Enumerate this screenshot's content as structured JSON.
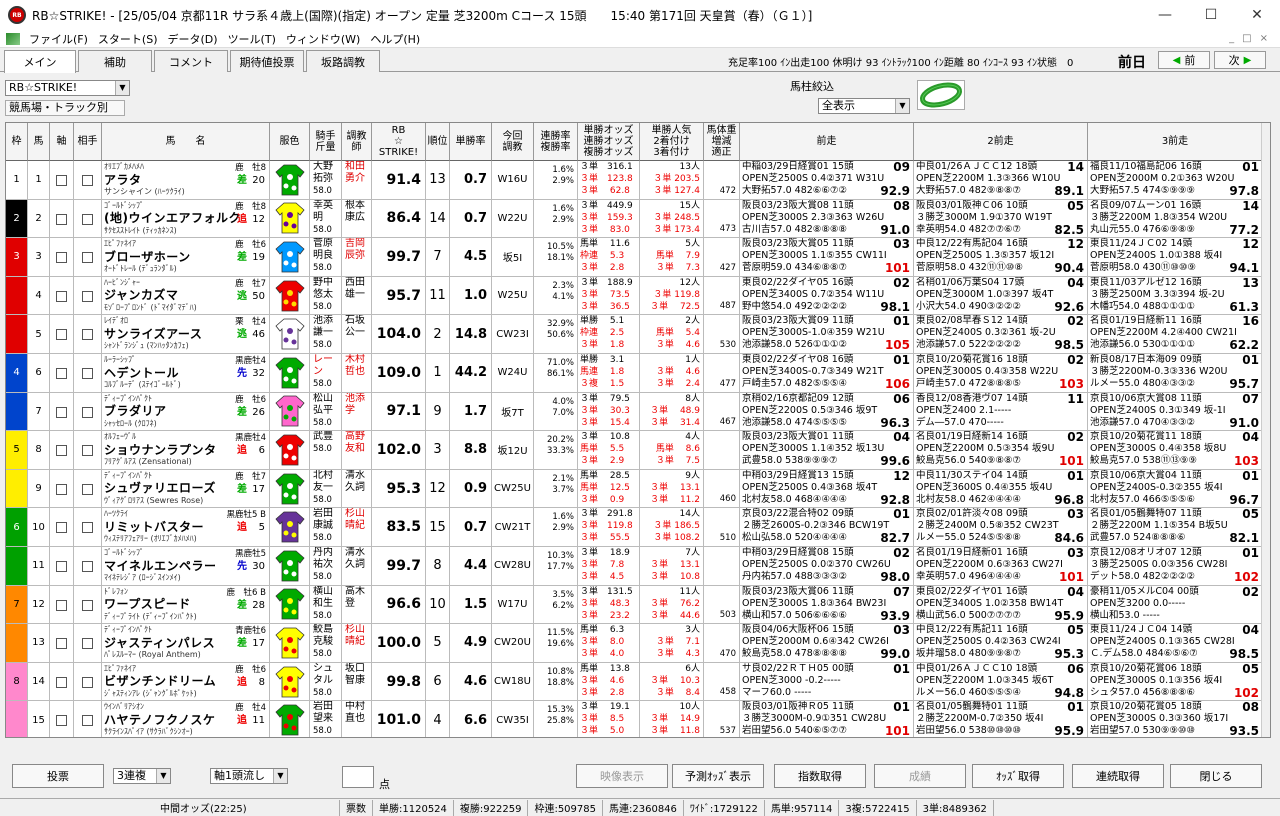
{
  "window": {
    "title": "RB☆STRIKE! - [25/05/04 京都11R サラ系４歳上(国際)(指定) オープン 定量 芝3200m Cコース 15頭　　15:40 第171回 天皇賞（春）（Ｇ１）]",
    "minimize": "—",
    "maximize": "☐",
    "close": "✕"
  },
  "menu": [
    "ファイル(F)",
    "スタート(S)",
    "データ(D)",
    "ツール(T)",
    "ウィンドウ(W)",
    "ヘルプ(H)"
  ],
  "mdi_controls": [
    "_",
    "□",
    "×"
  ],
  "tabs": [
    "メイン",
    "補助",
    "コメント",
    "期待値投票",
    "坂路調教"
  ],
  "filter_info": "充足率100 ｲﾝ出走100 休明け 93 ｲﾝﾄﾗｯｸ100 ｲﾝ距離 80 ｲﾝｺｰｽ 93 ｲﾝ状態　0",
  "prev_label": "前日",
  "nav": {
    "prev": "前",
    "next": "次"
  },
  "controls": {
    "mode_select": "RB☆STRIKE!",
    "track_select": "競馬場・トラック別",
    "umabashira_label": "馬柱絞込",
    "umabashira_select": "全表示"
  },
  "headers": {
    "waku": "枠",
    "uma": "馬",
    "jiku": "軸",
    "aite": "相手",
    "horse": "馬　　名",
    "silk": "服色",
    "jockey": "騎手\n斤量",
    "trainer": "調教\n師",
    "rb": "RB\n☆\nSTRIKE!",
    "rank": "順位",
    "win": "単勝率",
    "training": "今回\n調教",
    "rate": "連勝率\n複勝率",
    "odds": "単勝オッズ\n連勝オッズ\n複勝オッズ",
    "ninki": "単勝人気\n2着付け\n3着付け",
    "weight": "馬体重\n増減\n適正",
    "race1": "前走",
    "race2": "2前走",
    "race3": "3前走"
  },
  "horses": [
    {
      "waku": "1",
      "uma": "1",
      "sire": "ｵﾘｴﾌﾞｶﾒﾊﾒﾊ",
      "sexage": "鹿　牡8",
      "name": "アラタ",
      "dam": "サンシャイン (ﾊｰﾂｸﾗｲ)",
      "style": "差",
      "odds": "20",
      "jockey": "大野\n拓弥",
      "kg": "58.0",
      "trainer": "和田\n勇介",
      "trainer_red": true,
      "rb": "91.4",
      "rank": "13",
      "win": "0.7",
      "training": "W16U",
      "rate": "1.6%\n2.9%",
      "oz": [
        "３単　316.1",
        "３単　123.8",
        "３単　 62.8"
      ],
      "ninki": [
        "13人",
        "３単 203.5",
        "３単 127.4"
      ],
      "wt": "472",
      "r1": [
        "中稲03/29日経賞01 15頭",
        "OPEN芝2500S 0.4②371 W31U",
        "大野拓57.0 482⑥⑥⑦②"
      ],
      "r1s": "09",
      "r1n": "92.9",
      "r2": [
        "中良01/26ＡＪＣＣ12 18頭",
        "OPEN芝2200M 1.3③366 W10U",
        "大野拓57.0 482⑨⑧⑧⑦"
      ],
      "r2s": "14",
      "r2n": "89.1",
      "r3": [
        "福良11/10福島記06 16頭",
        "OPEN芝2000M 0.2①363 W20U",
        "大野拓57.5 474⑤⑨⑨⑨"
      ],
      "r3s": "01",
      "r3n": "97.8"
    },
    {
      "waku": "2",
      "uma": "2",
      "sire": "ｺﾞｰﾙﾄﾞｼｯﾌﾟ",
      "sexage": "鹿　牡8",
      "name": "(地)ウインエアフォルク",
      "dam": "ｻｸｾｽｽﾄﾚｲﾄ (ﾃｨｯｶﾈﾝｽ)",
      "style": "追",
      "odds": "12",
      "jockey": "幸英\n明",
      "kg": "58.0",
      "trainer": "根本\n康広",
      "trainer_red": false,
      "rb": "86.4",
      "rank": "14",
      "win": "0.7",
      "training": "W22U",
      "rate": "1.6%\n2.9%",
      "oz": [
        "３単　449.9",
        "３単　159.3",
        "３単　 83.0"
      ],
      "ninki": [
        "15人",
        "３単 248.5",
        "３単 173.4"
      ],
      "wt": "473",
      "r1": [
        "阪良03/23阪大賞08 11頭",
        "OPEN芝3000S 2.3③363 W26U",
        "古川吉57.0 482⑧⑧⑧⑧"
      ],
      "r1s": "08",
      "r1n": "91.0",
      "r2": [
        "阪良03/01阪神Ｃ06 10頭",
        "３勝芝3000M 1.9①370 W19T",
        "幸英明54.0 482⑦⑦⑥⑦"
      ],
      "r2s": "05",
      "r2n": "82.5",
      "r3": [
        "名良09/07ムーン01 16頭",
        "３勝芝2200M 1.8③354 W20U",
        "丸山元55.0 476⑥⑨⑧⑨"
      ],
      "r3s": "14",
      "r3n": "77.2"
    },
    {
      "waku": "3",
      "uma": "3",
      "sire": "ｴﾋﾟﾌｧﾈｲｱ",
      "sexage": "鹿　牡6",
      "name": "ブローザホーン",
      "dam": "ｵｰﾄﾞﾄﾚｰﾙ (ﾃﾞｭﾗﾝﾀﾞﾙ)",
      "style": "差",
      "odds": "19",
      "jockey": "菅原\n明良",
      "kg": "58.0",
      "trainer": "吉岡\n辰弥",
      "trainer_red": true,
      "rb": "99.7",
      "rank": "7",
      "win": "4.5",
      "training": "坂5I",
      "rate": "10.5%\n18.1%",
      "oz": [
        "馬単　 11.6",
        "枠連　 5.3",
        "３単　 2.8"
      ],
      "ninki": [
        "5人",
        "馬単　 7.9",
        "３単　 7.3"
      ],
      "wt": "427",
      "r1": [
        "阪良03/23阪大賞05 11頭",
        "OPEN芝3000S 1.1⑤355 CW11I",
        "菅原明59.0 434⑥⑧⑧⑦"
      ],
      "r1s": "03",
      "r1n": "101",
      "r2": [
        "中良12/22有馬記04 16頭",
        "OPEN芝2500S 1.3⑤357 坂12I",
        "菅原明58.0 432⑪⑪⑩⑧"
      ],
      "r2s": "12",
      "r2n": "90.4",
      "r3": [
        "東良11/24ＪＣ02 14頭",
        "OPEN芝2400S 1.0①388 坂4I",
        "菅原明58.0 430⑪⑩⑩⑨"
      ],
      "r3s": "12",
      "r3n": "94.1"
    },
    {
      "waku": "3",
      "uma": "4",
      "sire": "ﾊｰﾋﾞﾝｼﾞｬｰ",
      "sexage": "鹿　牡7",
      "name": "ジャンカズマ",
      "dam": "ﾓｿﾞﾛｰﾌﾟﾛﾝﾄﾞ (ﾄﾞﾏｲﾀﾞﾏﾃﾞﾊ)",
      "style": "逃",
      "odds": "50",
      "jockey": "野中\n悠太",
      "kg": "58.0",
      "trainer": "西田\n雄一",
      "trainer_red": false,
      "rb": "95.7",
      "rank": "11",
      "win": "1.0",
      "training": "W25U",
      "rate": "2.3%\n4.1%",
      "oz": [
        "３単　188.9",
        "３単　 73.5",
        "３単　 36.5"
      ],
      "ninki": [
        "12人",
        "３単 119.8",
        "３単　 72.5"
      ],
      "wt": "487",
      "r1": [
        "東良02/22ダイヤ05 16頭",
        "OPEN芝3400S 0.7②354 W11U",
        "野中悠54.0 492②②②②"
      ],
      "r1s": "02",
      "r1n": "98.1",
      "r2": [
        "名稍01/06万葉S04 17頭",
        "OPEN芝3000M 1.0③397 坂4T",
        "小沢大54.0 490③②②②"
      ],
      "r2s": "04",
      "r2n": "92.6",
      "r3": [
        "東良11/03アルゼ12 16頭",
        "３勝芝2500M 3.3③394 坂-2U",
        "木幡巧54.0 488①①①①"
      ],
      "r3s": "13",
      "r3n": "61.3"
    },
    {
      "waku": "3",
      "uma": "5",
      "sire": "ﾚｲﾃﾞｵﾛ",
      "sexage": "栗　牡4",
      "name": "サンライズアース",
      "dam": "ｼｬﾝﾄﾞﾗﾝｼﾞｭ (ﾏﾝﾊｯﾀﾝｶﾌｪ)",
      "style": "逃",
      "odds": "46",
      "jockey": "池添\n謙一",
      "kg": "58.0",
      "trainer": "石坂\n公一",
      "trainer_red": false,
      "rb": "104.0",
      "rank": "2",
      "win": "14.8",
      "training": "CW23I",
      "rate": "32.9%\n50.6%",
      "oz": [
        "単勝　 5.1",
        "枠連　 2.5",
        "３単　 1.8"
      ],
      "ninki": [
        "2人",
        "馬単　 5.4",
        "３単　 4.6"
      ],
      "wt": "530",
      "r1": [
        "阪良03/23阪大賞09 11頭",
        "OPEN芝3000S-1.0④359 W21U",
        "池添謙58.0 526①①①②"
      ],
      "r1s": "01",
      "r1n": "105",
      "r2": [
        "東良02/08早春Ｓ12 14頭",
        "OPEN芝2400S 0.3②361 坂-2U",
        "池添謙57.0 522②②②②"
      ],
      "r2s": "02",
      "r2n": "98.5",
      "r3": [
        "名良01/19日経新11 16頭",
        "OPEN芝2200M 4.2④400 CW21I",
        "池添謙56.0 530①①①①"
      ],
      "r3s": "16",
      "r3n": "62.2"
    },
    {
      "waku": "4",
      "uma": "6",
      "sire": "ﾙｰﾗｰｼｯﾌﾟ",
      "sexage": "黒鹿牡4",
      "name": "ヘデントール",
      "dam": "ｺﾙﾌﾞﾙｰﾃﾞ (ｽﾃｲｺﾞｰﾙﾄﾞ)",
      "style": "先",
      "odds": "32",
      "jockey": "レー\nン",
      "kg": "58.0",
      "jockey_red": true,
      "trainer": "木村\n哲也",
      "trainer_red": true,
      "rb": "109.0",
      "rank": "1",
      "win": "44.2",
      "training": "W24U",
      "rate": "71.0%\n86.1%",
      "oz": [
        "単勝　 3.1",
        "馬連　 1.8",
        "３複　 1.5"
      ],
      "ninki": [
        "1人",
        "３単　 4.6",
        "３単　 2.4"
      ],
      "wt": "477",
      "r1": [
        "東良02/22ダイヤ08 16頭",
        "OPEN芝3400S-0.7③349 W21T",
        "戸崎圭57.0 482⑤⑤⑤④"
      ],
      "r1s": "01",
      "r1n": "106",
      "r2": [
        "京良10/20菊花賞16 18頭",
        "OPEN芝3000S 0.4③358 W22U",
        "戸崎圭57.0 472⑧⑧⑧⑤"
      ],
      "r2s": "02",
      "r2n": "103",
      "r3": [
        "新良08/17日本海09 09頭",
        "３勝芝2200M-0.3③336 W20U",
        "ルメー55.0 480④③③②"
      ],
      "r3s": "01",
      "r3n": "95.7"
    },
    {
      "waku": "4",
      "uma": "7",
      "sire": "ﾃﾞｨｰﾌﾟｲﾝﾊﾟｸﾄ",
      "sexage": "鹿　牡6",
      "name": "ブラダリア",
      "dam": "ｼｬｯｾﾛｰﾙ (ｸﾛﾌﾈ)",
      "style": "差",
      "odds": "26",
      "jockey": "松山\n弘平",
      "kg": "58.0",
      "trainer": "池添\n学",
      "trainer_red": true,
      "rb": "97.1",
      "rank": "9",
      "win": "1.7",
      "training": "坂7T",
      "rate": "4.0%\n7.0%",
      "oz": [
        "３単　 79.5",
        "３単　 30.3",
        "３単　 15.4"
      ],
      "ninki": [
        "8人",
        "３単　 48.9",
        "３単　 31.4"
      ],
      "wt": "467",
      "r1": [
        "京稍02/16京都記09 12頭",
        "OPEN芝2200S 0.5③346 坂9T",
        "池添謙58.0 474⑤⑤⑤⑤"
      ],
      "r1s": "06",
      "r1n": "96.3",
      "r2": [
        "香良12/08香港ヴ07 14頭",
        "OPEN芝2400 2.1-----",
        "デム―57.0 470-----"
      ],
      "r2s": "11",
      "r2n": "",
      "r3": [
        "京良10/06京大賞08 11頭",
        "OPEN芝2400S 0.3①349 坂-1I",
        "池添謙57.0 470④③③②"
      ],
      "r3s": "07",
      "r3n": "91.0"
    },
    {
      "waku": "5",
      "uma": "8",
      "sire": "ｵﾙﾌｪｰｳﾞﾙ",
      "sexage": "黒鹿牡4",
      "name": "ショウナンラプンタ",
      "dam": "ﾌﾘｱｸﾞﾙｱｽ (Zensational)",
      "style": "追",
      "odds": "6",
      "jockey": "武豊",
      "kg": "58.0",
      "trainer": "高野\n友和",
      "trainer_red": true,
      "rb": "102.0",
      "rank": "3",
      "win": "8.8",
      "training": "坂12U",
      "rate": "20.2%\n33.3%",
      "oz": [
        "３単　 10.8",
        "馬単　 5.5",
        "３単　 2.9"
      ],
      "ninki": [
        "4人",
        "馬単　 8.6",
        "３単　 7.5"
      ],
      "wt": "",
      "r1": [
        "阪良03/23阪大賞01 11頭",
        "OPEN芝3000S 1.1④352 坂13U",
        "武豊58.0 538⑨⑨⑨⑦"
      ],
      "r1s": "04",
      "r1n": "99.6",
      "r2": [
        "名良01/19日経新14 16頭",
        "OPEN芝2200M 0.5③354 坂9U",
        "鮫島克56.0 540⑨⑧⑧⑦"
      ],
      "r2s": "02",
      "r2n": "101",
      "r3": [
        "京良10/20菊花賞11 18頭",
        "OPEN芝3000S 0.4④358 坂8U",
        "鮫島克57.0 538⑪⑬⑨⑨"
      ],
      "r3s": "04",
      "r3n": "103"
    },
    {
      "waku": "5",
      "uma": "9",
      "sire": "ﾃﾞｨｰﾌﾟｲﾝﾊﾟｸﾄ",
      "sexage": "鹿　牡7",
      "name": "シュヴァリエローズ",
      "dam": "ｳﾞｨｱｸﾞﾛﾘｱｽ (Sewres Rose)",
      "style": "差",
      "odds": "17",
      "jockey": "北村\n友一",
      "kg": "58.0",
      "trainer": "清水\n久詞",
      "trainer_red": false,
      "rb": "95.3",
      "rank": "12",
      "win": "0.9",
      "training": "CW25U",
      "rate": "2.1%\n3.7%",
      "oz": [
        "馬単　 28.5",
        "馬単　 12.5",
        "３単　 0.9"
      ],
      "ninki": [
        "9人",
        "３単　 13.1",
        "３単　 11.2"
      ],
      "wt": "460",
      "r1": [
        "中稍03/29日経賞13 15頭",
        "OPEN芝2500S 0.4③368 坂4T",
        "北村友58.0 468④④④④"
      ],
      "r1s": "12",
      "r1n": "92.8",
      "r2": [
        "中良11/30ステイ04 14頭",
        "OPEN芝3600S 0.4④355 坂4U",
        "北村友58.0 462④④④④"
      ],
      "r2s": "01",
      "r2n": "96.8",
      "r3": [
        "京良10/06京大賞04 11頭",
        "OPEN芝2400S-0.3②355 坂4I",
        "北村友57.0 466⑤⑤⑤⑥"
      ],
      "r3s": "01",
      "r3n": "96.7"
    },
    {
      "waku": "6",
      "uma": "10",
      "sire": "ﾊｰﾂｸﾗｲ",
      "sexage": "黒鹿牡5 B",
      "name": "リミットバスター",
      "dam": "ｳｨｽﾃﾘｱﾌｪｱﾘｰ (ｵﾘｴﾌﾞｶﾒﾊﾒﾊ)",
      "style": "追",
      "odds": "5",
      "jockey": "岩田\n康誠",
      "kg": "58.0",
      "trainer": "杉山\n晴紀",
      "trainer_red": true,
      "rb": "83.5",
      "rank": "15",
      "win": "0.7",
      "training": "CW21T",
      "rate": "1.6%\n2.9%",
      "oz": [
        "３単　291.8",
        "３単　119.8",
        "３単　 55.5"
      ],
      "ninki": [
        "14人",
        "３単 186.5",
        "３単 108.2"
      ],
      "wt": "510",
      "r1": [
        "京良03/22混合特02 09頭",
        "２勝芝2600S-0.2③346 BCW19T",
        "松山弘58.0 520④④④④"
      ],
      "r1s": "01",
      "r1n": "82.7",
      "r2": [
        "京良02/01許淡々08 09頭",
        "２勝芝2400M 0.5⑧352 CW23T",
        "ルメー55.0 524⑤⑤⑧⑧"
      ],
      "r2s": "03",
      "r2n": "84.6",
      "r3": [
        "名良01/05鶴舞特07 11頭",
        "２勝芝2200M 1.1⑤354 B坂5U",
        "武豊57.0 524⑧⑧⑧⑥"
      ],
      "r3s": "05",
      "r3n": "82.1"
    },
    {
      "waku": "6",
      "uma": "11",
      "sire": "ｺﾞｰﾙﾄﾞｼｯﾌﾟ",
      "sexage": "黒鹿牡5",
      "name": "マイネルエンペラー",
      "dam": "ﾏｲﾈﾃﾚｼﾞｱ (ﾛｰｼﾞｽｲﾝﾒｲ)",
      "style": "先",
      "odds": "30",
      "jockey": "丹内\n祐次",
      "kg": "58.0",
      "trainer": "清水\n久詞",
      "trainer_red": false,
      "rb": "99.7",
      "rank": "8",
      "win": "4.4",
      "training": "CW28U",
      "rate": "10.3%\n17.7%",
      "oz": [
        "３単　 18.9",
        "３単　 7.8",
        "３単　 4.5"
      ],
      "ninki": [
        "7人",
        "３単　 13.1",
        "３単　 10.8"
      ],
      "wt": "",
      "r1": [
        "中稍03/29日経賞08 15頭",
        "OPEN芝2500S 0.0②370 CW26U",
        "丹内祐57.0 488③③③②"
      ],
      "r1s": "02",
      "r1n": "98.0",
      "r2": [
        "名良01/19日経新01 16頭",
        "OPEN芝2200M 0.6③363 CW27I",
        "幸英明57.0 496④④④④"
      ],
      "r2s": "03",
      "r2n": "101",
      "r3": [
        "京良12/08オリオ07 12頭",
        "３勝芝2500S 0.0③356 CW28I",
        "デット58.0 482②②②②"
      ],
      "r3s": "01",
      "r3n": "102"
    },
    {
      "waku": "7",
      "uma": "12",
      "sire": "ﾄﾞﾚﾌｫﾝ",
      "sexage": "鹿　牡6 B",
      "name": "ワープスピード",
      "dam": "ﾃﾞｨｰﾌﾟﾗｲﾄ (ﾃﾞｨｰﾌﾟｲﾝﾊﾟｸﾄ)",
      "style": "差",
      "odds": "28",
      "jockey": "横山\n和生",
      "kg": "58.0",
      "trainer": "高木\n登",
      "trainer_red": false,
      "rb": "96.6",
      "rank": "10",
      "win": "1.5",
      "training": "W17U",
      "rate": "3.5%\n6.2%",
      "oz": [
        "３単　131.5",
        "３単　 48.3",
        "３単　 23.2"
      ],
      "ninki": [
        "11人",
        "３単　 76.2",
        "３単　 44.6"
      ],
      "wt": "503",
      "r1": [
        "阪良03/23阪大賞06 11頭",
        "OPEN芝3000S 1.8③364 BW23I",
        "横山和57.0 506⑥⑥⑥⑥"
      ],
      "r1s": "07",
      "r1n": "93.9",
      "r2": [
        "東良02/22ダイヤ01 16頭",
        "OPEN芝3400S 1.0②358 BW14T",
        "横山武56.0 500⑦⑦⑦⑦"
      ],
      "r2s": "04",
      "r2n": "95.9",
      "r3": [
        "豪稍11/05メルC04 00頭",
        "OPEN芝3200 0.0-----",
        "横山和53.0 -----"
      ],
      "r3s": "02",
      "r3n": ""
    },
    {
      "waku": "7",
      "uma": "13",
      "sire": "ﾃﾞｨｰﾌﾟｲﾝﾊﾟｸﾄ",
      "sexage": "青鹿牡6",
      "name": "ジャスティンパレス",
      "dam": "ﾊﾟﾚｽﾙｰﾏｰ (Royal Anthem)",
      "style": "差",
      "odds": "17",
      "jockey": "鮫島\n克駿",
      "kg": "58.0",
      "trainer": "杉山\n晴紀",
      "trainer_red": true,
      "rb": "100.0",
      "rank": "5",
      "win": "4.9",
      "training": "CW20U",
      "rate": "11.5%\n19.6%",
      "oz": [
        "馬単　 6.3",
        "３単　 8.0",
        "３単　 4.0"
      ],
      "ninki": [
        "3人",
        "３単　 7.1",
        "３単　 4.3"
      ],
      "wt": "470",
      "r1": [
        "阪良04/06大阪杯06 15頭",
        "OPEN芝2000M 0.6④342 CW26I",
        "鮫島克58.0 478⑧⑧⑧⑧"
      ],
      "r1s": "03",
      "r1n": "99.0",
      "r2": [
        "中良12/22有馬記11 16頭",
        "OPEN芝2500S 0.4②363 CW24I",
        "坂井瑠58.0 480⑨⑨⑧⑦"
      ],
      "r2s": "05",
      "r2n": "95.3",
      "r3": [
        "東良11/24ＪＣ04 14頭",
        "OPEN芝2400S 0.1③365 CW28I",
        "Ｃ.デム58.0 484⑥⑤⑥⑦"
      ],
      "r3s": "04",
      "r3n": "98.5"
    },
    {
      "waku": "8",
      "uma": "14",
      "sire": "ｴﾋﾟﾌｧﾈｲｱ",
      "sexage": "鹿　牡6",
      "name": "ビザンチンドリーム",
      "dam": "ｼﾞｬｽﾃｨﾝｱﾚ (ｼﾞｬﾝｸﾞﾙﾎﾟｹｯﾄ)",
      "style": "追",
      "odds": "8",
      "jockey": "シュ\nタル",
      "kg": "58.0",
      "trainer": "坂口\n智康",
      "trainer_red": false,
      "rb": "99.8",
      "rank": "6",
      "win": "4.6",
      "training": "CW18U",
      "rate": "10.8%\n18.8%",
      "oz": [
        "馬単　 13.8",
        "３単　 4.6",
        "３単　 2.8"
      ],
      "ninki": [
        "6人",
        "３単　 10.3",
        "３単　 8.4"
      ],
      "wt": "458",
      "r1": [
        "サ良02/22ＲＴＨ05 00頭",
        "OPEN芝3000 -0.2-----",
        "マーフ60.0 -----"
      ],
      "r1s": "01",
      "r1n": "",
      "r2": [
        "中良01/26ＡＪＣＣ10 18頭",
        "OPEN芝2200M 1.0③345 坂6T",
        "ルメー56.0 460⑤⑤⑤④"
      ],
      "r2s": "06",
      "r2n": "94.8",
      "r3": [
        "京良10/20菊花賞06 18頭",
        "OPEN芝3000S 0.1③356 坂4I",
        "シュタ57.0 456⑧⑧⑧⑥"
      ],
      "r3s": "05",
      "r3n": "102"
    },
    {
      "waku": "8",
      "uma": "15",
      "sire": "ｳｲﾝﾊﾞﾘｱｼｵﾝ",
      "sexage": "鹿　牡4",
      "name": "ハヤテノフクノスケ",
      "dam": "ｻｸﾗｲﾝｽﾊﾟｲｱ (ｻｸﾗﾊﾞｸｼﾝｵｰ)",
      "style": "追",
      "odds": "11",
      "jockey": "岩田\n望来",
      "kg": "58.0",
      "trainer": "中村\n直也",
      "trainer_red": false,
      "rb": "101.0",
      "rank": "4",
      "win": "6.6",
      "training": "CW35I",
      "rate": "15.3%\n25.8%",
      "oz": [
        "３単　 19.1",
        "３単　 8.5",
        "３単　 5.0"
      ],
      "ninki": [
        "10人",
        "３単　 14.9",
        "３単　 11.8"
      ],
      "wt": "537",
      "r1": [
        "阪良03/01阪神Ｒ05 11頭",
        "３勝芝3000M-0.9①351 CW28U",
        "岩田望56.0 540⑥⑤⑦⑦"
      ],
      "r1s": "01",
      "r1n": "101",
      "r2": [
        "名良01/05鶴舞特01 11頭",
        "２勝芝2200M-0.7②350 坂4I",
        "岩田望56.0 538⑩⑩⑩⑩"
      ],
      "r2s": "01",
      "r2n": "95.9",
      "r3": [
        "京良10/20菊花賞05 18頭",
        "OPEN芝3000S 0.3③360 坂17I",
        "岩田望57.0 530⑨⑨⑩⑩"
      ],
      "r3s": "08",
      "r3n": "93.5"
    }
  ],
  "waku_colors": {
    "1": "#ffffff",
    "2": "#000000",
    "3": "#e00000",
    "4": "#0044cc",
    "5": "#ffee00",
    "6": "#00a000",
    "7": "#ff8800",
    "8": "#ff88cc"
  },
  "bottom": {
    "vote": "投票",
    "bet_type": "3連複",
    "bet_mode": "軸1頭流し",
    "points_unit": "点",
    "video": "映像表示",
    "predict": "予測ｵｯｽﾞ表示",
    "index": "指数取得",
    "result": "成績",
    "odds": "ｵｯｽﾞ取得",
    "renzoku": "連続取得",
    "close": "閉じる"
  },
  "status": {
    "mid": "中間オッズ(22:25)",
    "votes": "票数",
    "tansho": "単勝:1120524",
    "fukusho": "複勝:922259",
    "wakuren": "枠連:509785",
    "umaren": "馬連:2360846",
    "wide": "ﾜｲﾄﾞ:1729122",
    "umatan": "馬単:957114",
    "sanpuku": "3複:5722415",
    "santan": "3単:8489362"
  }
}
